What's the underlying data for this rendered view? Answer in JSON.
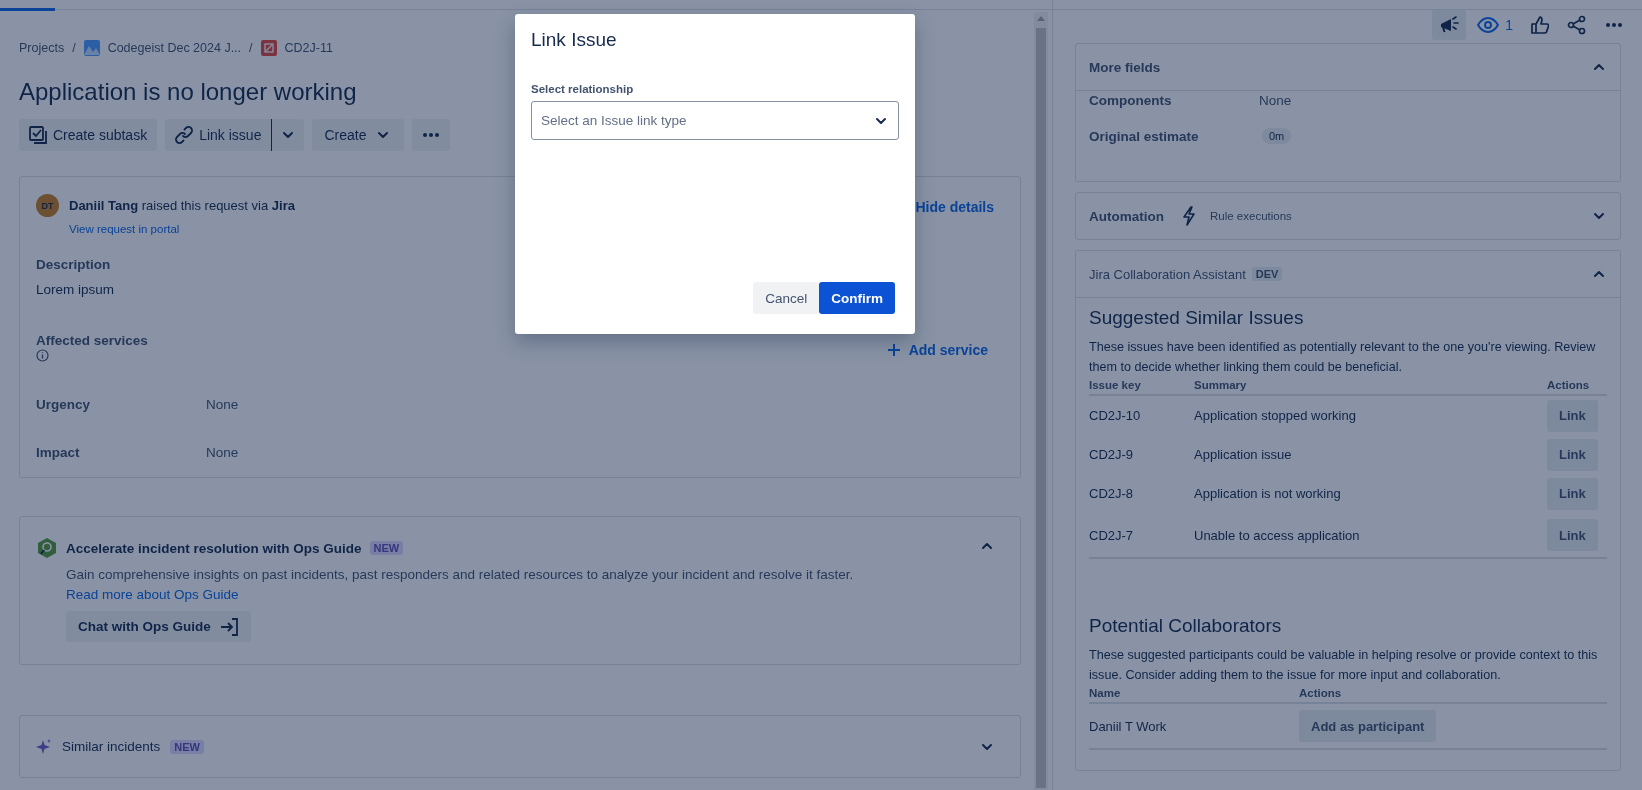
{
  "breadcrumbs": [
    {
      "label": "Projects",
      "kind": "text",
      "separator": "/"
    },
    {
      "label": "Codegeist Dec 2024 J...",
      "kind": "project",
      "separator": "/"
    },
    {
      "label": "CD2J-11",
      "kind": "issue"
    }
  ],
  "issue": {
    "title": "Application is no longer working",
    "actions": [
      {
        "label": "Create subtask",
        "kind": "subtask"
      },
      {
        "label": "Link issue",
        "kind": "split"
      },
      {
        "label": "Create",
        "kind": "dropdown"
      },
      {
        "kind": "more"
      }
    ]
  },
  "request": {
    "avatar": "DT",
    "line": "**Daniil Tang** raised this request via **Jira**",
    "portal_link": "View request in portal",
    "toggle": "Hide details",
    "fields": [
      {
        "label": "Description",
        "value": "Lorem ipsum",
        "kind": "stacked"
      },
      {
        "label": "Affected services",
        "action": "Add service",
        "kind": "service"
      },
      {
        "label": "Urgency",
        "value": "None",
        "kind": "inline"
      },
      {
        "label": "Impact",
        "value": "None",
        "kind": "inline"
      }
    ]
  },
  "ops_guide": {
    "title": "Accelerate incident resolution with Ops Guide",
    "badge": "NEW",
    "expanded": true,
    "text": "Gain comprehensive insights on past incidents, past responders and related resources to analyze your incident and resolve it faster.",
    "link": "Read more about Ops Guide",
    "button": "Chat with Ops Guide"
  },
  "similar_incidents": {
    "title": "Similar incidents",
    "badge": "NEW",
    "expanded": false
  },
  "toolbar": {
    "watchers": "1"
  },
  "more_fields": {
    "title": "More fields",
    "expanded": true,
    "fields": [
      {
        "label": "Components",
        "value": "None",
        "kind": "text"
      },
      {
        "label": "Original estimate",
        "value": "0m",
        "kind": "lozenge"
      }
    ]
  },
  "automation": {
    "title": "Automation",
    "subtitle": "Rule executions",
    "expanded": false
  },
  "assistant": {
    "title": "Jira Collaboration Assistant",
    "badge": "DEV",
    "expanded": true,
    "similar": {
      "heading": "Suggested Similar Issues",
      "text": "These issues have been identified as potentially relevant to the one you're viewing. Review them to decide whether linking them could be beneficial.",
      "columns": [
        "Issue key",
        "Summary",
        "Actions"
      ],
      "rows": [
        {
          "key": "CD2J-10",
          "summary": "Application stopped working",
          "action": "Link"
        },
        {
          "key": "CD2J-9",
          "summary": "Application issue",
          "action": "Link"
        },
        {
          "key": "CD2J-8",
          "summary": "Application is not working",
          "action": "Link"
        },
        {
          "key": "CD2J-7",
          "summary": "Unable to access application",
          "action": "Link"
        }
      ]
    },
    "collaborators": {
      "heading": "Potential Collaborators",
      "text": "These suggested participants could be valuable in helping resolve or provide context to this issue. Consider adding them to the issue for more input and collaboration.",
      "columns": [
        "Name",
        "Actions"
      ],
      "rows": [
        {
          "name": "Daniil T Work",
          "action": "Add as participant"
        }
      ]
    }
  },
  "dialog": {
    "title": "Link Issue",
    "field_label": "Select relationship",
    "placeholder": "Select an Issue link type",
    "buttons": [
      {
        "label": "Cancel",
        "kind": "subtle"
      },
      {
        "label": "Confirm",
        "kind": "primary"
      }
    ]
  }
}
